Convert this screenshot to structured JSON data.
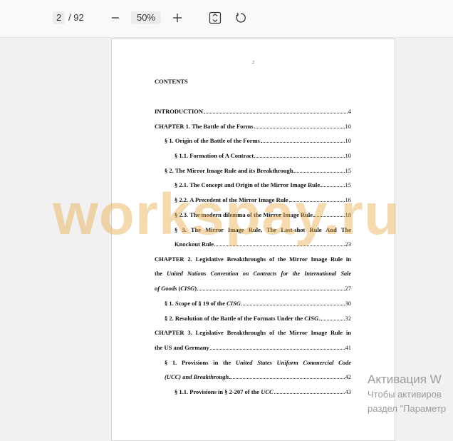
{
  "toolbar": {
    "page_current": "2",
    "page_total": "/ 92",
    "zoom": "50%",
    "icons": [
      "zoom-out-icon",
      "zoom-in-icon",
      "fit-page-icon",
      "rotate-icon"
    ]
  },
  "page": {
    "page_number": "2",
    "heading": "CONTENTS"
  },
  "toc": [
    {
      "prefix": "INTRODUCTION",
      "title": "",
      "page": "4"
    },
    {
      "prefix": "CHAPTER 1.",
      "title": "The Battle of the Forms",
      "page": "10"
    },
    {
      "prefix": "§ 1.",
      "title": "Origin of the Battle of the Forms",
      "page": "10"
    },
    {
      "prefix": "§ 1.1.",
      "title": "Formation of A Contract",
      "page": "10"
    },
    {
      "prefix": "§ 2.",
      "title": "The Mirror Image Rule and its Breakthrough",
      "page": "15"
    },
    {
      "prefix": "§ 2.1.",
      "title": "The Concept and Origin of the Mirror Image Rule",
      "page": "15"
    },
    {
      "prefix": "§ 2.2.",
      "title": "A Precedent of the Mirror Image Rule",
      "page": "16"
    },
    {
      "prefix": "§ 2.3.",
      "title": "The modern dilemma of the Mirror Image Rule",
      "page": "18"
    },
    {
      "prefix": "§ 3.",
      "title": "The Mirror Image Rule, The Last-shot Rule And The",
      "title_cont": "Knockout Rule",
      "page": "23"
    },
    {
      "prefix": "CHAPTER 2.",
      "title": "Legislative Breakthroughs of the Mirror Image Rule in",
      "line2a": "the",
      "line2b": "United Nations Convention on Contracts for the International Sale",
      "line3a": "of Goods",
      "line3b": "(",
      "line3c": "CISG",
      "line3d": ")",
      "page": "27"
    },
    {
      "prefix": "§ 1.",
      "title": "Scope of § 19 of the",
      "title_it": "CISG",
      "page": "30"
    },
    {
      "prefix": "§ 2.",
      "title": "Resolution of the Battle of the Formats Under the",
      "title_it": "CISG",
      "title_end": ".",
      "page": "32"
    },
    {
      "prefix": "CHAPTER 3.",
      "title": "Legislative Breakthroughs of the Mirror Image Rule in",
      "line2": "the US and Germany",
      "page": "41"
    },
    {
      "prefix": "§ 1.",
      "title": "Provisions in the",
      "title_it": "United States Uniform Commercial Code",
      "line2": "(UCC) and Breakthrough",
      "page": "42"
    },
    {
      "prefix": "§ 1.1.",
      "title": "Provisions in § 2-207 of the",
      "title_it": "UCC",
      "page": "43"
    }
  ],
  "watermark": "workspay.ru",
  "os_notice": {
    "line1": "Активация W",
    "line2": "Чтобы активиров",
    "line3": "раздел \"Параметр"
  }
}
